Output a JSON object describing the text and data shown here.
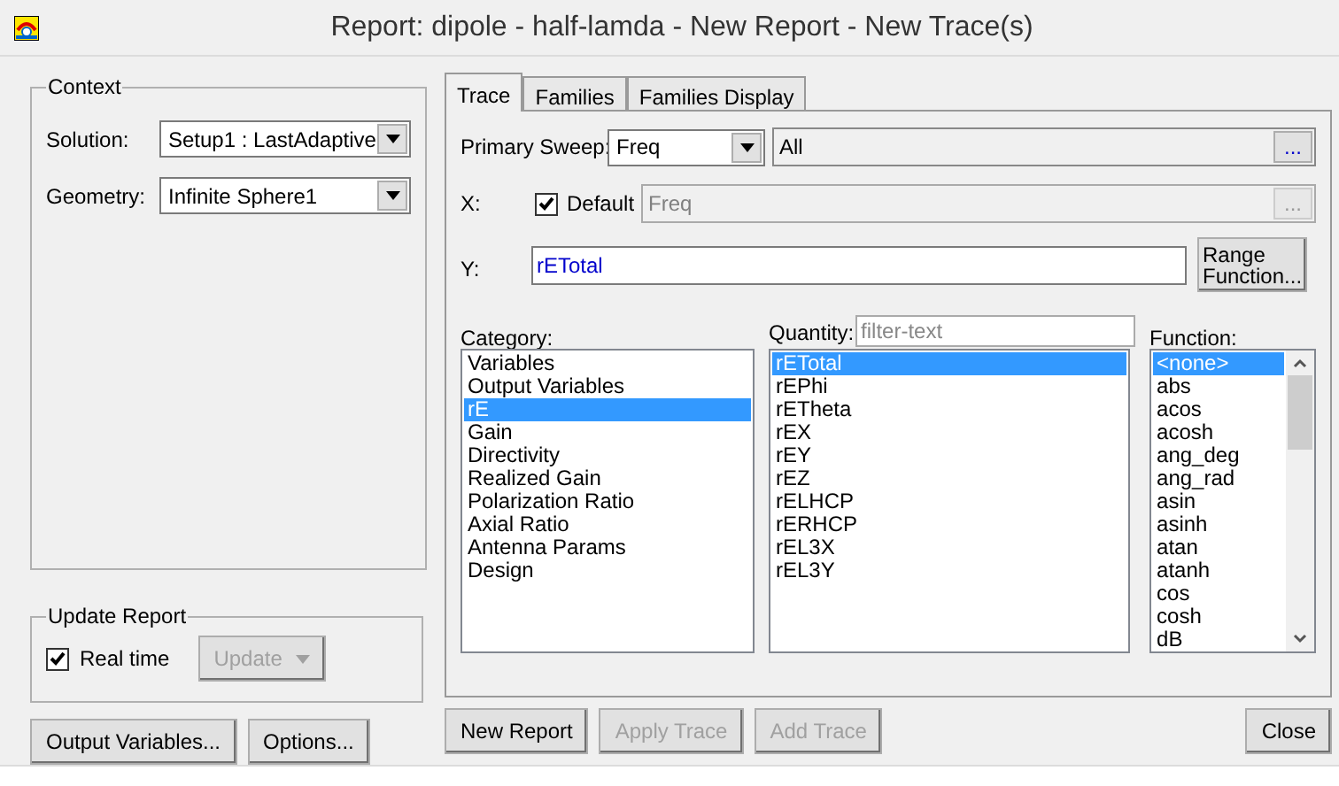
{
  "window": {
    "title": "Report: dipole - half-lamda - New Report - New Trace(s)"
  },
  "context": {
    "title": "Context",
    "solution": {
      "label": "Solution:",
      "value": "Setup1 : LastAdaptive"
    },
    "geometry": {
      "label": "Geometry:",
      "value": "Infinite Sphere1"
    }
  },
  "update_report": {
    "title": "Update Report",
    "real_time": {
      "label": "Real time",
      "checked": true
    },
    "update_button": {
      "label": "Update",
      "disabled": true
    }
  },
  "left_buttons": [
    {
      "label": "Output Variables...",
      "disabled": false
    },
    {
      "label": "Options...",
      "disabled": false
    }
  ],
  "tabs": [
    {
      "label": "Trace",
      "selected": true
    },
    {
      "label": "Families",
      "selected": false
    },
    {
      "label": "Families Display",
      "selected": false
    }
  ],
  "trace": {
    "primary_sweep": {
      "label": "Primary Sweep:",
      "value": "Freq"
    },
    "sweep_values": {
      "value": "All",
      "button": "..."
    },
    "x": {
      "label": "X:",
      "default": {
        "label": "Default",
        "checked": true
      },
      "value": "Freq",
      "disabled": true,
      "button": "..."
    },
    "y": {
      "label": "Y:",
      "value": "rETotal"
    },
    "range_function_button": "Range Function...",
    "category": {
      "label": "Category:",
      "items": [
        {
          "label": "Variables",
          "selected": false
        },
        {
          "label": "Output Variables",
          "selected": false
        },
        {
          "label": "rE",
          "selected": true
        },
        {
          "label": "Gain",
          "selected": false
        },
        {
          "label": "Directivity",
          "selected": false
        },
        {
          "label": "Realized Gain",
          "selected": false
        },
        {
          "label": "Polarization Ratio",
          "selected": false
        },
        {
          "label": "Axial Ratio",
          "selected": false
        },
        {
          "label": "Antenna Params",
          "selected": false
        },
        {
          "label": "Design",
          "selected": false
        }
      ]
    },
    "quantity": {
      "label": "Quantity:",
      "placeholder": "filter-text",
      "items": [
        {
          "label": "rETotal",
          "selected": true
        },
        {
          "label": "rEPhi",
          "selected": false
        },
        {
          "label": "rETheta",
          "selected": false
        },
        {
          "label": "rEX",
          "selected": false
        },
        {
          "label": "rEY",
          "selected": false
        },
        {
          "label": "rEZ",
          "selected": false
        },
        {
          "label": "rELHCP",
          "selected": false
        },
        {
          "label": "rERHCP",
          "selected": false
        },
        {
          "label": "rEL3X",
          "selected": false
        },
        {
          "label": "rEL3Y",
          "selected": false
        }
      ]
    },
    "function": {
      "label": "Function:",
      "items": [
        {
          "label": "<none>",
          "selected": true
        },
        {
          "label": "abs",
          "selected": false
        },
        {
          "label": "acos",
          "selected": false
        },
        {
          "label": "acosh",
          "selected": false
        },
        {
          "label": "ang_deg",
          "selected": false
        },
        {
          "label": "ang_rad",
          "selected": false
        },
        {
          "label": "asin",
          "selected": false
        },
        {
          "label": "asinh",
          "selected": false
        },
        {
          "label": "atan",
          "selected": false
        },
        {
          "label": "atanh",
          "selected": false
        },
        {
          "label": "cos",
          "selected": false
        },
        {
          "label": "cosh",
          "selected": false
        },
        {
          "label": "dB",
          "selected": false
        }
      ]
    }
  },
  "bottom_buttons": [
    {
      "label": "New Report",
      "disabled": false
    },
    {
      "label": "Apply Trace",
      "disabled": true
    },
    {
      "label": "Add Trace",
      "disabled": true
    }
  ],
  "close_button": "Close"
}
